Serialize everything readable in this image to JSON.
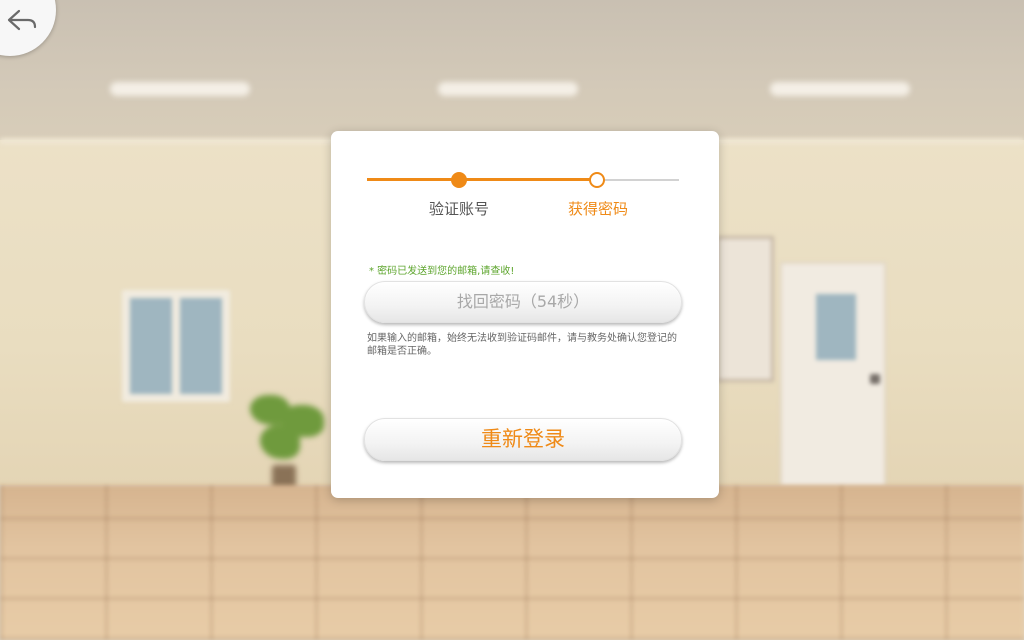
{
  "back_button": {
    "icon": "back-arrow-icon"
  },
  "stepper": {
    "progress": 2,
    "steps": [
      {
        "label": "验证账号",
        "state": "done"
      },
      {
        "label": "获得密码",
        "state": "current"
      }
    ]
  },
  "notice": "* 密码已发送到您的邮箱,请查收!",
  "retrieve_button": {
    "label": "找回密码（54秒）",
    "disabled": true
  },
  "help_text": "如果输入的邮箱，始终无法收到验证码邮件，请与教务处确认您登记的邮箱是否正确。",
  "relogin_button": {
    "label": "重新登录"
  },
  "colors": {
    "accent": "#ef8a17",
    "success_text": "#5da52d",
    "disabled_text": "#a8a8a8"
  }
}
